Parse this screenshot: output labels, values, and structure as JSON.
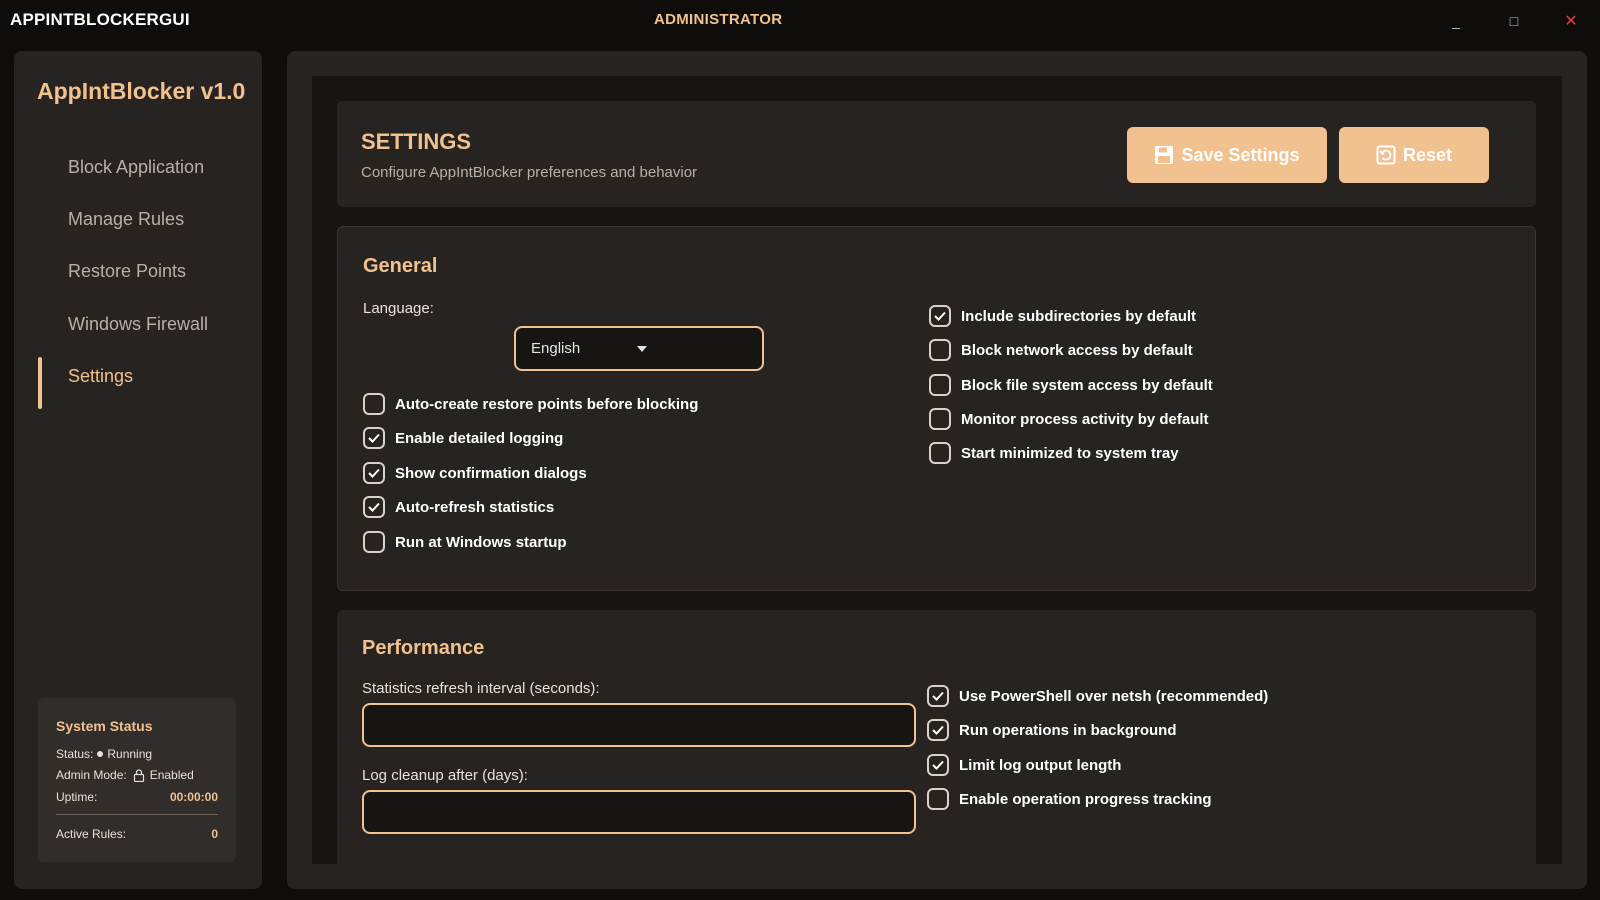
{
  "window": {
    "caption": "APPINTBLOCKERGUI",
    "role": "ADMINISTRATOR",
    "controls": {
      "minimize": "_",
      "maximize": "□",
      "close": "✕"
    }
  },
  "sidebar": {
    "brand": "AppIntBlocker v1.0",
    "items": [
      {
        "label": "Block Application"
      },
      {
        "label": "Manage Rules"
      },
      {
        "label": "Restore Points"
      },
      {
        "label": "Windows Firewall"
      },
      {
        "label": "Settings",
        "active": true
      }
    ],
    "status": {
      "title": "System Status",
      "status_label": "Status:",
      "status_value": "Running",
      "admin_label": "Admin Mode:",
      "admin_value": "Enabled",
      "uptime_label": "Uptime:",
      "uptime_value": "00:00:00",
      "rules_label": "Active Rules:",
      "rules_value": "0"
    }
  },
  "header": {
    "title": "SETTINGS",
    "subtitle": "Configure AppIntBlocker preferences and behavior",
    "save_label": "Save Settings",
    "reset_label": "Reset"
  },
  "general": {
    "title": "General",
    "language_label": "Language:",
    "language_value": "English",
    "left_options": [
      {
        "label": "Auto-create restore points before blocking",
        "checked": false
      },
      {
        "label": "Enable detailed logging",
        "checked": true
      },
      {
        "label": "Show confirmation dialogs",
        "checked": true
      },
      {
        "label": "Auto-refresh statistics",
        "checked": true
      },
      {
        "label": "Run at Windows startup",
        "checked": false
      }
    ],
    "right_options": [
      {
        "label": "Include subdirectories by default",
        "checked": true
      },
      {
        "label": "Block network access by default",
        "checked": false
      },
      {
        "label": "Block file system access by default",
        "checked": false
      },
      {
        "label": "Monitor process activity by default",
        "checked": false
      },
      {
        "label": "Start minimized to system tray",
        "checked": false
      }
    ]
  },
  "performance": {
    "title": "Performance",
    "refresh_label": "Statistics refresh interval (seconds):",
    "refresh_value": "",
    "cleanup_label": "Log cleanup after (days):",
    "cleanup_value": "",
    "right_options": [
      {
        "label": "Use PowerShell over netsh (recommended)",
        "checked": true
      },
      {
        "label": "Run operations in background",
        "checked": true
      },
      {
        "label": "Limit log output length",
        "checked": true
      },
      {
        "label": "Enable operation progress tracking",
        "checked": false
      }
    ]
  },
  "colors": {
    "accent": "#f2c190",
    "panel": "#262320",
    "background": "#171513"
  }
}
